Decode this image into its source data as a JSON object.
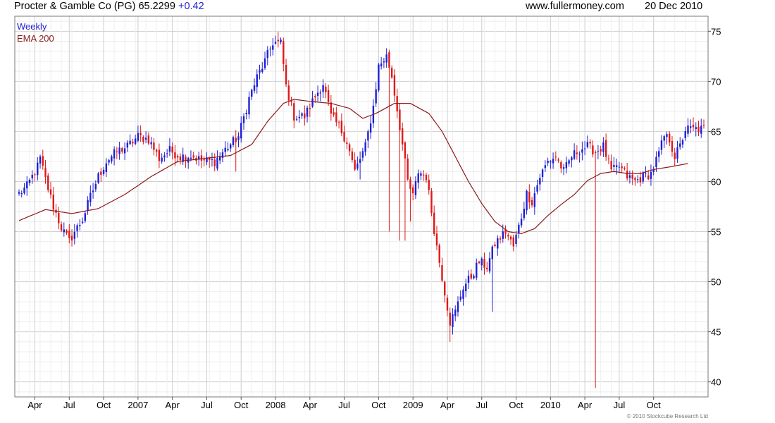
{
  "header": {
    "title": "Procter & Gamble Co (PG) 65.2299",
    "change": "+0.42",
    "site": "www.fullermoney.com",
    "date": "20 Dec 2010"
  },
  "colors": {
    "up": "#1f1fd6",
    "down": "#e01818",
    "ema": "#8b1a1a",
    "grid": "#d8d8d8"
  },
  "copyright": "© 2010 Stockcube Research Ltd",
  "chart_data": {
    "type": "candlestick",
    "frequency": "Weekly",
    "series": [
      {
        "name": "Weekly",
        "color": "#1f1fd6"
      },
      {
        "name": "EMA 200",
        "color": "#8b1a1a"
      }
    ],
    "ylim": [
      38.5,
      76.5
    ],
    "yticks": [
      40,
      45,
      50,
      55,
      60,
      65,
      70,
      75
    ],
    "x_tick_labels": [
      {
        "label": "Apr",
        "week": 6
      },
      {
        "label": "Jul",
        "week": 19
      },
      {
        "label": "Oct",
        "week": 32
      },
      {
        "label": "2007",
        "week": 45
      },
      {
        "label": "Apr",
        "week": 58
      },
      {
        "label": "Jul",
        "week": 71
      },
      {
        "label": "Oct",
        "week": 84
      },
      {
        "label": "2008",
        "week": 97
      },
      {
        "label": "Apr",
        "week": 110
      },
      {
        "label": "Jul",
        "week": 123
      },
      {
        "label": "Oct",
        "week": 136
      },
      {
        "label": "2009",
        "week": 149
      },
      {
        "label": "Apr",
        "week": 162
      },
      {
        "label": "Jul",
        "week": 175
      },
      {
        "label": "Oct",
        "week": 188
      },
      {
        "label": "2010",
        "week": 201
      },
      {
        "label": "Apr",
        "week": 214
      },
      {
        "label": "Jul",
        "week": 227
      },
      {
        "label": "Oct",
        "week": 240
      }
    ],
    "total_weeks": 260,
    "close_anchors": [
      [
        0,
        58.8
      ],
      [
        3,
        59.5
      ],
      [
        7,
        61.5
      ],
      [
        8,
        62.3
      ],
      [
        10,
        60.2
      ],
      [
        13,
        57.5
      ],
      [
        16,
        55.4
      ],
      [
        19,
        54.0
      ],
      [
        21,
        55.0
      ],
      [
        24,
        56.2
      ],
      [
        27,
        58.5
      ],
      [
        30,
        60.5
      ],
      [
        33,
        62.0
      ],
      [
        37,
        63.0
      ],
      [
        41,
        63.5
      ],
      [
        45,
        64.5
      ],
      [
        49,
        64.2
      ],
      [
        53,
        62.3
      ],
      [
        57,
        63.1
      ],
      [
        61,
        62.5
      ],
      [
        65,
        62.6
      ],
      [
        69,
        62.1
      ],
      [
        74,
        62.0
      ],
      [
        78,
        63.2
      ],
      [
        83,
        64.5
      ],
      [
        87,
        68.3
      ],
      [
        90,
        70.4
      ],
      [
        93,
        72.0
      ],
      [
        96,
        73.9
      ],
      [
        99,
        73.8
      ],
      [
        101,
        69.5
      ],
      [
        104,
        66.5
      ],
      [
        108,
        66.5
      ],
      [
        112,
        68.5
      ],
      [
        115,
        69.8
      ],
      [
        118,
        66.5
      ],
      [
        121,
        65.5
      ],
      [
        124,
        64.0
      ],
      [
        127,
        61.0
      ],
      [
        131,
        63.5
      ],
      [
        134,
        67.5
      ],
      [
        136,
        71.5
      ],
      [
        139,
        72.5
      ],
      [
        141,
        70.5
      ],
      [
        144,
        65.5
      ],
      [
        147,
        60.0
      ],
      [
        149,
        58.5
      ],
      [
        151,
        61.0
      ],
      [
        154,
        60.5
      ],
      [
        156,
        57.0
      ],
      [
        158,
        53.5
      ],
      [
        161,
        49.0
      ],
      [
        163,
        46.0
      ],
      [
        165,
        47.0
      ],
      [
        168,
        49.5
      ],
      [
        171,
        50.5
      ],
      [
        174,
        52.0
      ],
      [
        177,
        51.5
      ],
      [
        180,
        53.8
      ],
      [
        184,
        55.0
      ],
      [
        187,
        53.5
      ],
      [
        190,
        56.5
      ],
      [
        192,
        58.8
      ],
      [
        194,
        58.0
      ],
      [
        197,
        60.5
      ],
      [
        200,
        62.0
      ],
      [
        203,
        62.5
      ],
      [
        206,
        61.0
      ],
      [
        209,
        62.5
      ],
      [
        212,
        63.2
      ],
      [
        215,
        63.5
      ],
      [
        218,
        63.0
      ],
      [
        221,
        63.5
      ],
      [
        224,
        61.0
      ],
      [
        227,
        61.5
      ],
      [
        230,
        60.5
      ],
      [
        233,
        60.0
      ],
      [
        236,
        60.5
      ],
      [
        239,
        60.8
      ],
      [
        242,
        62.8
      ],
      [
        244,
        64.5
      ],
      [
        246,
        64.2
      ],
      [
        248,
        62.5
      ],
      [
        250,
        63.5
      ],
      [
        252,
        65.2
      ],
      [
        253,
        65.23
      ]
    ],
    "notable_lows": [
      {
        "week": 82,
        "low": 61.0
      },
      {
        "week": 129,
        "low": 60.2
      },
      {
        "week": 140,
        "low": 55.0
      },
      {
        "week": 144,
        "low": 54.1
      },
      {
        "week": 146,
        "low": 54.1
      },
      {
        "week": 148,
        "low": 56.0
      },
      {
        "week": 163,
        "low": 44.0
      },
      {
        "week": 179,
        "low": 47.0
      },
      {
        "week": 218,
        "low": 39.4
      }
    ],
    "ema_anchors": [
      [
        0,
        56.1
      ],
      [
        10,
        57.2
      ],
      [
        20,
        56.8
      ],
      [
        30,
        57.3
      ],
      [
        40,
        58.7
      ],
      [
        50,
        60.5
      ],
      [
        60,
        62.0
      ],
      [
        70,
        62.3
      ],
      [
        80,
        62.6
      ],
      [
        88,
        63.7
      ],
      [
        94,
        66.0
      ],
      [
        100,
        67.8
      ],
      [
        104,
        68.2
      ],
      [
        110,
        68.0
      ],
      [
        118,
        67.8
      ],
      [
        125,
        67.3
      ],
      [
        130,
        66.3
      ],
      [
        135,
        66.8
      ],
      [
        142,
        67.8
      ],
      [
        148,
        67.8
      ],
      [
        155,
        66.8
      ],
      [
        160,
        65.0
      ],
      [
        165,
        62.5
      ],
      [
        170,
        60.0
      ],
      [
        175,
        57.8
      ],
      [
        180,
        56.0
      ],
      [
        185,
        55.0
      ],
      [
        190,
        54.8
      ],
      [
        195,
        55.3
      ],
      [
        200,
        56.6
      ],
      [
        205,
        57.7
      ],
      [
        210,
        58.7
      ],
      [
        215,
        60.1
      ],
      [
        220,
        60.8
      ],
      [
        225,
        61.0
      ],
      [
        230,
        60.8
      ],
      [
        235,
        60.8
      ],
      [
        240,
        61.2
      ],
      [
        247,
        61.5
      ],
      [
        253,
        61.8
      ]
    ]
  }
}
